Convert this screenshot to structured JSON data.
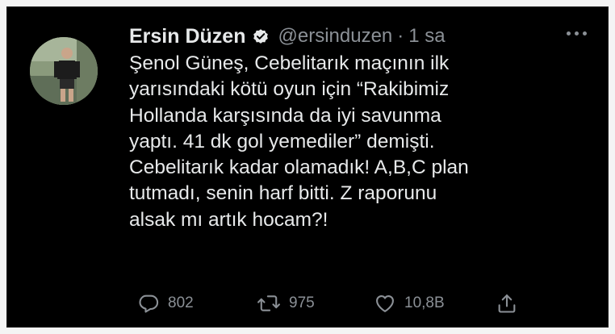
{
  "tweet": {
    "author_name": "Ersin Düzen",
    "handle": "@ersinduzen",
    "separator": "·",
    "time": "1 sa",
    "text_lines": [
      "Şenol Güneş, Cebelitarık maçının ilk",
      "yarısındaki kötü oyun için “Rakibimiz",
      "Hollanda karşısında da iyi savunma",
      "yaptı. 41 dk gol yemediler” demişti.",
      "Cebelitarık kadar olamadık! A,B,C plan",
      "tutmadı, senin harf bitti. Z raporunu",
      "alsak mı artık hocam?!"
    ]
  },
  "actions": {
    "reply_count": "802",
    "retweet_count": "975",
    "like_count": "10,8B"
  },
  "icons": {
    "verified": "verified-badge-icon",
    "more": "more-options-icon",
    "reply": "reply-icon",
    "retweet": "retweet-icon",
    "like": "heart-icon",
    "share": "share-icon"
  },
  "colors": {
    "background": "#000000",
    "text": "#e7e9ea",
    "secondary_text": "#8b9096"
  }
}
